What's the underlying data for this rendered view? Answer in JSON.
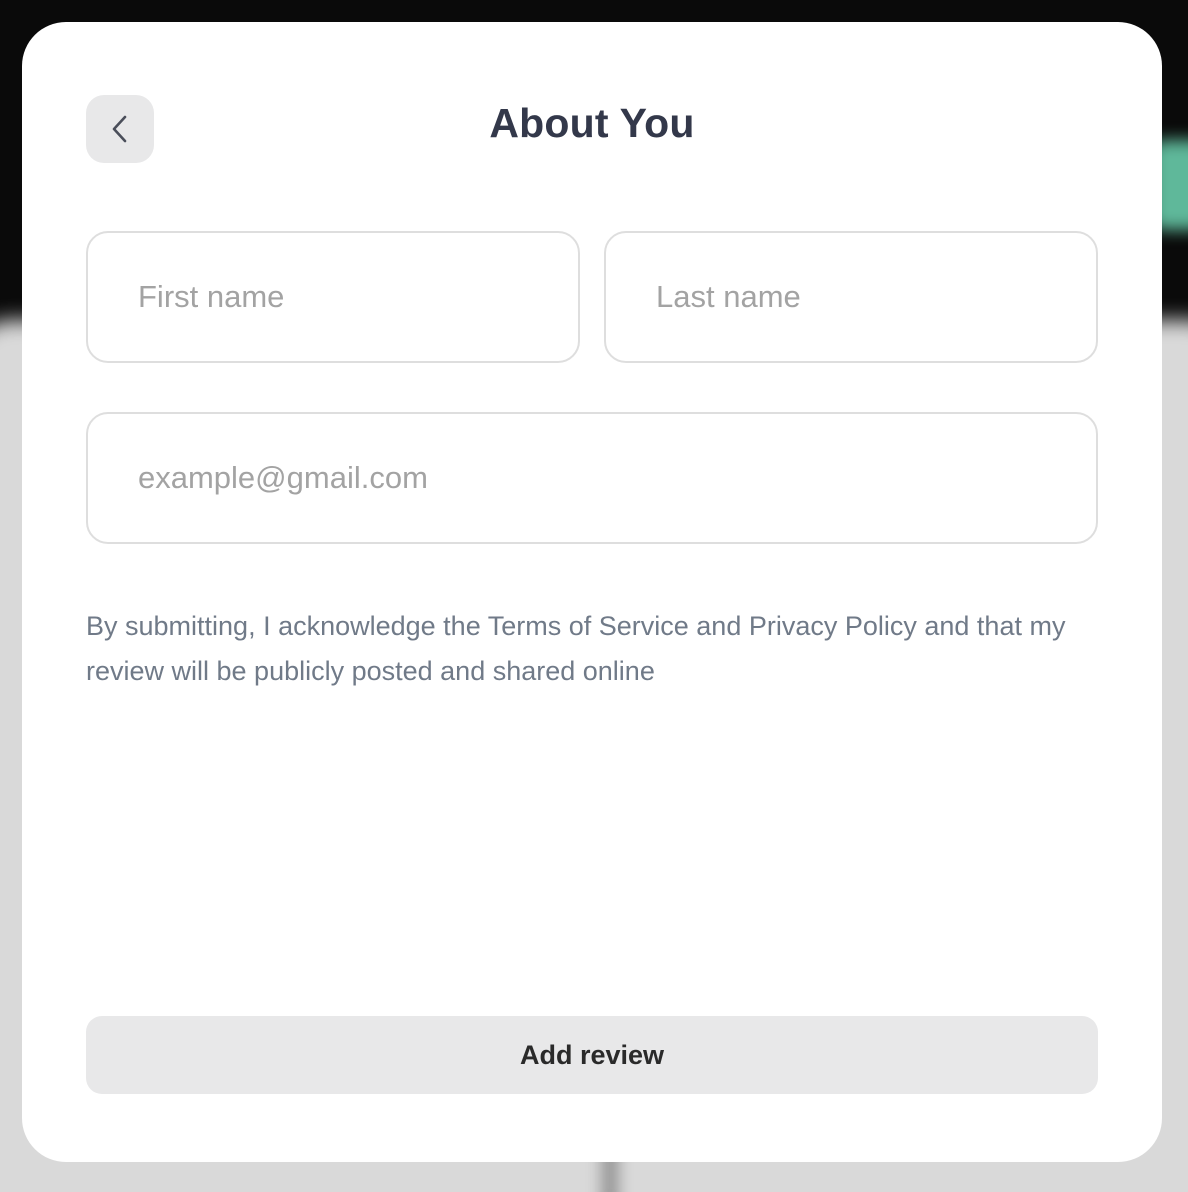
{
  "modal": {
    "title": "About You",
    "back_icon": "chevron-left-icon"
  },
  "form": {
    "first_name": {
      "placeholder": "First name",
      "value": ""
    },
    "last_name": {
      "placeholder": "Last name",
      "value": ""
    },
    "email": {
      "placeholder": "example@gmail.com",
      "value": ""
    },
    "terms_text": "By submitting, I acknowledge the Terms of Service and Privacy Policy and that my review will be publicly posted and shared online",
    "submit_label": "Add review"
  },
  "colors": {
    "title": "#33384a",
    "terms_text": "#707a88",
    "button_bg": "#e8e8e9",
    "field_border": "#dedede",
    "backdrop_accent": "#5fb89a"
  }
}
